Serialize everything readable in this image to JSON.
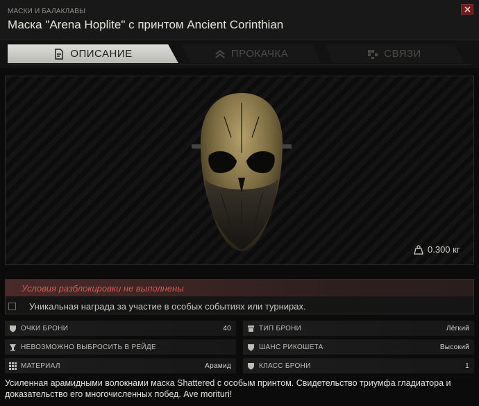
{
  "header": {
    "category": "МАСКИ И БАЛАКЛАВЫ",
    "title": "Маска \"Arena Hoplite\" с принтом Ancient Corinthian"
  },
  "tabs": [
    {
      "label": "ОПИСАНИЕ",
      "icon": "document-icon",
      "active": true
    },
    {
      "label": "ПРОКАЧКА",
      "icon": "upgrade-chevrons-icon",
      "active": false
    },
    {
      "label": "СВЯЗИ",
      "icon": "links-icon",
      "active": false
    }
  ],
  "preview": {
    "weight": "0.300 кг"
  },
  "unlock": {
    "title": "Условия разблокировки не выполнены",
    "condition": "Уникальная награда за участие в особых событиях или турнирах."
  },
  "stats": [
    {
      "label": "ОЧКИ БРОНИ",
      "value": "40",
      "icon": "shield-icon"
    },
    {
      "label": "ТИП БРОНИ",
      "value": "Лёгкий",
      "icon": "armor-type-icon"
    },
    {
      "label": "НЕВОЗМОЖНО ВЫБРОСИТЬ В РЕЙДЕ",
      "value": "",
      "icon": "cup-icon"
    },
    {
      "label": "ШАНС РИКОШЕТА",
      "value": "Высокий",
      "icon": "ricochet-icon"
    },
    {
      "label": "МАТЕРИАЛ",
      "value": "Арамид",
      "icon": "grid-icon"
    },
    {
      "label": "КЛАСС БРОНИ",
      "value": "1",
      "icon": "armor-class-icon"
    }
  ],
  "description": "Усиленная арамидными волокнами маска Shattered с особым принтом. Свидетельство триумфа гладиатора и доказательство его многочисленных побед. Ave morituri!",
  "colors": {
    "accent_red": "#d25b4f",
    "active_tab": "#d3d3ce",
    "close_button": "#6e1b1b"
  }
}
